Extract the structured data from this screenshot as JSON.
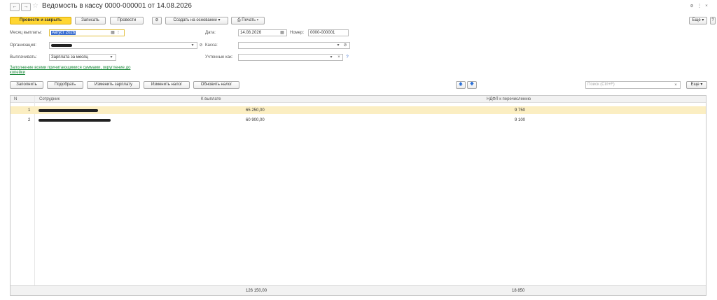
{
  "header": {
    "back": "←",
    "forward": "→",
    "star": "☆",
    "title": "Ведомость в кассу 0000-000001 от 14.08.2026",
    "link_icon": "⊘",
    "menu_icon": "⋮",
    "close_icon": "×"
  },
  "toolbar": {
    "post_and_close": "Провести и закрыть",
    "save": "Записать",
    "post": "Провести",
    "attach_icon": "⊘",
    "create_based_on": "Создать на основании ▾",
    "print": "⎙ Печать ▾",
    "more": "Еще ▾",
    "help": "?"
  },
  "form": {
    "month_label": "Месяц выплаты:",
    "month_value": "Август 2026",
    "date_label": "Дата:",
    "date_value": "14.08.2026",
    "number_label": "Номер:",
    "number_value": "0000-000001",
    "org_label": "Организация:",
    "cash_label": "Касса:",
    "pay_label": "Выплачивать:",
    "pay_value": "Зарплата за месяц",
    "accounted_label": "Учтенные как:",
    "fill_link_line1": "Заполнение всеми причитающимися суммами, округление до",
    "fill_link_line2": "копейки",
    "calendar_icon": "▦",
    "dropdown_icon": "▾",
    "clear_icon": "×",
    "open_icon": "⊘",
    "help_icon": "?"
  },
  "table_toolbar": {
    "fill": "Заполнить",
    "pick": "Подобрать",
    "change_salary": "Изменить зарплату",
    "change_tax": "Изменить налог",
    "refresh_tax": "Обновить налог",
    "up_icon": "🡅",
    "down_icon": "🡇",
    "search_placeholder": "Поиск (Ctrl+F)",
    "search_clear": "×",
    "more": "Еще ▾"
  },
  "table": {
    "columns": [
      "N",
      "Сотрудник",
      "К выплате",
      "НДФЛ к перечислению"
    ],
    "rows": [
      {
        "n": "1",
        "to_pay": "65 250,00",
        "ndfl": "9 750"
      },
      {
        "n": "2",
        "to_pay": "60 900,00",
        "ndfl": "9 100"
      }
    ],
    "totals": {
      "to_pay": "126 150,00",
      "ndfl": "18 850"
    }
  },
  "colors": {
    "primary_button": "#ffd633",
    "selected_row": "#fbeec2",
    "link": "#1a8a3b",
    "month_highlight": "#3b6fd1"
  }
}
